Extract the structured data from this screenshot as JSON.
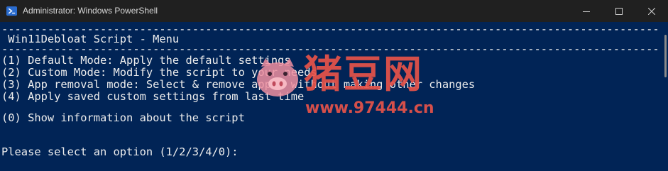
{
  "window": {
    "title": "Administrator: Windows PowerShell",
    "app_icon": "powershell-icon",
    "caption_buttons": [
      "minimize-icon",
      "maximize-icon",
      "close-icon"
    ]
  },
  "console": {
    "lines": [
      "--------------------------------------------------------------------------------------------------------------------------",
      " Win11Debloat Script - Menu",
      "--------------------------------------------------------------------------------------------------------------------------",
      "(1) Default Mode: Apply the default settings",
      "(2) Custom Mode: Modify the script to your needs",
      "(3) App removal mode: Select & remove apps, without making other changes",
      "(4) Apply saved custom settings from last time",
      "(0) Show information about the script",
      "Please select an option (1/2/3/4/0):"
    ]
  },
  "watermark": {
    "brand": "猪豆网",
    "url": "www.97444.cn",
    "logo": "pig-logo-icon"
  },
  "colors": {
    "console_bg": "#012456",
    "console_fg": "#ededed",
    "titlebar_bg": "#202020",
    "watermark": "#e8534a"
  }
}
